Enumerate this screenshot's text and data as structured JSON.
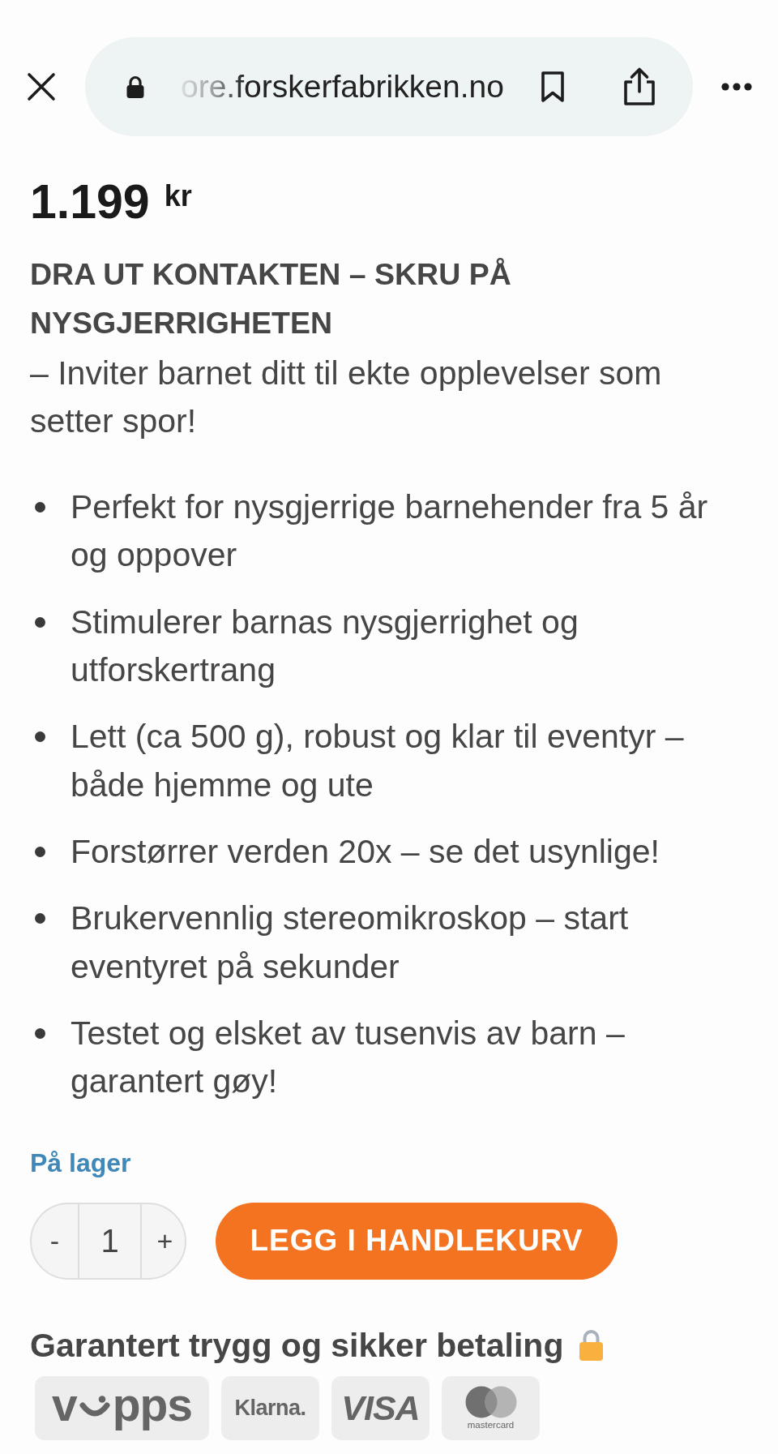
{
  "browser_bar": {
    "url": "ore.forskerfabrikken.no"
  },
  "product": {
    "price": "1.199",
    "currency": "kr",
    "headline": "DRA UT KONTAKTEN – SKRU PÅ NYSGJERRIGHETEN",
    "tagline": "– Inviter barnet ditt til ekte opplevelser som setter spor!",
    "features": [
      "Perfekt for nysgjerrige barnehender fra 5 år og oppover",
      "Stimulerer barnas nysgjerrighet og utforskertrang",
      "Lett (ca 500 g), robust og klar til eventyr – både hjemme og ute",
      "Forstørrer verden 20x – se det usynlige!",
      "Brukervennlig stereomikroskop – start eventyret på sekunder",
      "Testet og elsket av tusenvis av barn – garantert gøy!"
    ],
    "stock_status": "På lager",
    "quantity": {
      "decrease": "-",
      "value": "1",
      "increase": "+"
    },
    "add_to_cart": "LEGG I HANDLEKURV"
  },
  "payment": {
    "title": "Garantert trygg og sikker betaling",
    "methods": [
      {
        "kind": "vipps",
        "texts": [
          "v",
          "pps"
        ]
      },
      {
        "kind": "klarna",
        "texts": [
          "Klarna."
        ]
      },
      {
        "kind": "visa",
        "texts": [
          "VISA"
        ]
      },
      {
        "kind": "mastercard",
        "texts": [
          "mastercard"
        ]
      }
    ]
  }
}
